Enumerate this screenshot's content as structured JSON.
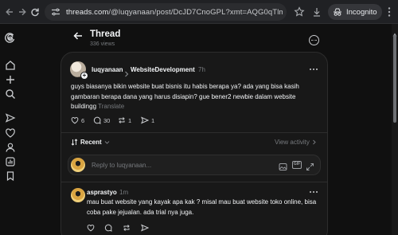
{
  "browser": {
    "url_host": "threads.com",
    "url_rest": "/@luqyanaan/post/DcJD7CnoGPL?xmt=AQG0qTlmF1n5KyCKYm...",
    "mode_label": "Incognito"
  },
  "header": {
    "title": "Thread",
    "views": "336 views"
  },
  "post": {
    "username": "luqyanaan",
    "topic": "WebsiteDevelopment",
    "time": "7h",
    "text": "guys biasanya bikin website buat bisnis itu habis berapa ya? ada yang bisa kasih gambaran berapa dana yang harus disiapin? gue bener2 newbie dalam website buildingg",
    "translate_label": "Translate",
    "likes": "6",
    "replies": "30",
    "reposts": "1",
    "shares": "1"
  },
  "sort": {
    "label": "Recent",
    "view_activity": "View activity"
  },
  "reply_box": {
    "placeholder": "Reply to luqyanaan..."
  },
  "comment": {
    "username": "asprastyo",
    "time": "1m",
    "text": "mau buat website yang kayak apa kak ? misal mau buat website toko online, bisa coba pake jejualan. ada trial nya juga."
  },
  "icons": {
    "sidebar": [
      "threads-logo-icon",
      "home-icon",
      "plus-icon",
      "search-icon",
      "send-icon",
      "heart-icon",
      "profile-icon",
      "insights-icon",
      "bookmark-icon"
    ],
    "gif_label": "GIF"
  },
  "colors": {
    "background": "#101010",
    "card": "#181818",
    "text": "#f3f5f7",
    "muted": "#777a7e"
  }
}
